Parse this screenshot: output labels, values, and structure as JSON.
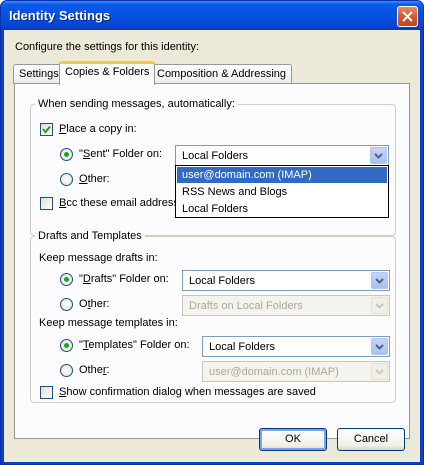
{
  "window": {
    "title": "Identity Settings"
  },
  "intro": "Configure the settings for this identity:",
  "tabs": [
    {
      "label": "Settings"
    },
    {
      "label": "Copies & Folders"
    },
    {
      "label": "Composition & Addressing"
    }
  ],
  "sending": {
    "group_label": "When sending messages, automatically:",
    "place_copy": {
      "label_pre": "P",
      "label_rest": "lace a copy in:",
      "checked": true
    },
    "sent_folder": {
      "label_pre": "\"",
      "label_u": "S",
      "label_rest": "ent\" Folder on:",
      "selected": true,
      "value": "Local Folders"
    },
    "other": {
      "label_pre": "",
      "label_u": "O",
      "label_rest": "ther:",
      "selected": false
    },
    "bcc": {
      "label_pre": "",
      "label_u": "B",
      "label_rest": "cc these email address",
      "checked": false
    },
    "dropdown_items": [
      "user@domain.com  (IMAP)",
      "RSS News and Blogs",
      "Local Folders"
    ]
  },
  "drafts": {
    "group_label": "Drafts and Templates",
    "drafts_heading": "Keep message drafts in:",
    "drafts_folder": {
      "label_pre": "\"",
      "label_u": "D",
      "label_rest": "rafts\" Folder on:",
      "selected": true,
      "value": "Local Folders"
    },
    "drafts_other": {
      "label_pre": "O",
      "label_u": "t",
      "label_rest": "her:",
      "selected": false,
      "value": "Drafts on Local Folders"
    },
    "templates_heading": "Keep message templates in:",
    "templates_folder": {
      "label_pre": "\"",
      "label_u": "T",
      "label_rest": "emplates\" Folder on:",
      "selected": true,
      "value": "Local Folders"
    },
    "templates_other": {
      "label_pre": "Othe",
      "label_u": "r",
      "label_rest": ":",
      "selected": false,
      "value": "user@domain.com  (IMAP)"
    },
    "confirm": {
      "label_pre": "",
      "label_u": "S",
      "label_rest": "how confirmation dialog when messages are saved",
      "checked": false
    }
  },
  "buttons": {
    "ok": "OK",
    "cancel": "Cancel"
  },
  "colors": {
    "titlebar": "#0453e0",
    "face": "#ece9d8",
    "selection": "#316ac5",
    "radio_dot": "#21a121"
  }
}
